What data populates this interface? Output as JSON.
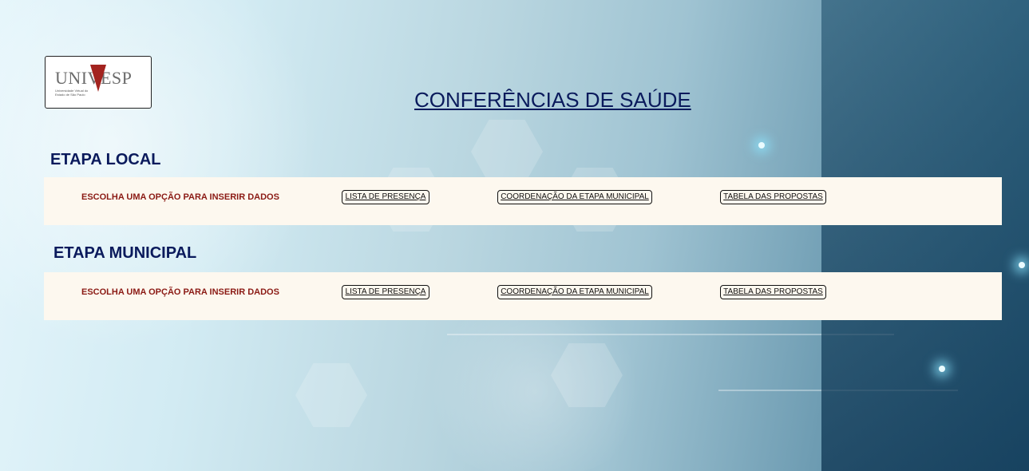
{
  "logo": {
    "word": "UNIVESP",
    "sub": "Universidade Virtual do Estado de São Paulo"
  },
  "page_title": "CONFERÊNCIAS DE SAÚDE",
  "sections": [
    {
      "title": "ETAPA LOCAL",
      "prompt": "ESCOLHA UMA OPÇÃO PARA INSERIR DADOS",
      "buttons": [
        "LISTA DE PRESENÇA",
        "COORDENAÇÃO DA ETAPA MUNICIPAL",
        "TABELA DAS PROPOSTAS"
      ]
    },
    {
      "title": "ETAPA MUNICIPAL",
      "prompt": "ESCOLHA UMA OPÇÃO PARA INSERIR DADOS",
      "buttons": [
        "LISTA DE PRESENÇA",
        "COORDENAÇÃO DA ETAPA MUNICIPAL",
        "TABELA DAS PROPOSTAS"
      ]
    }
  ],
  "colors": {
    "title": "#0a1a5c",
    "prompt": "#8b1a14",
    "band": "#fdf8ef"
  }
}
